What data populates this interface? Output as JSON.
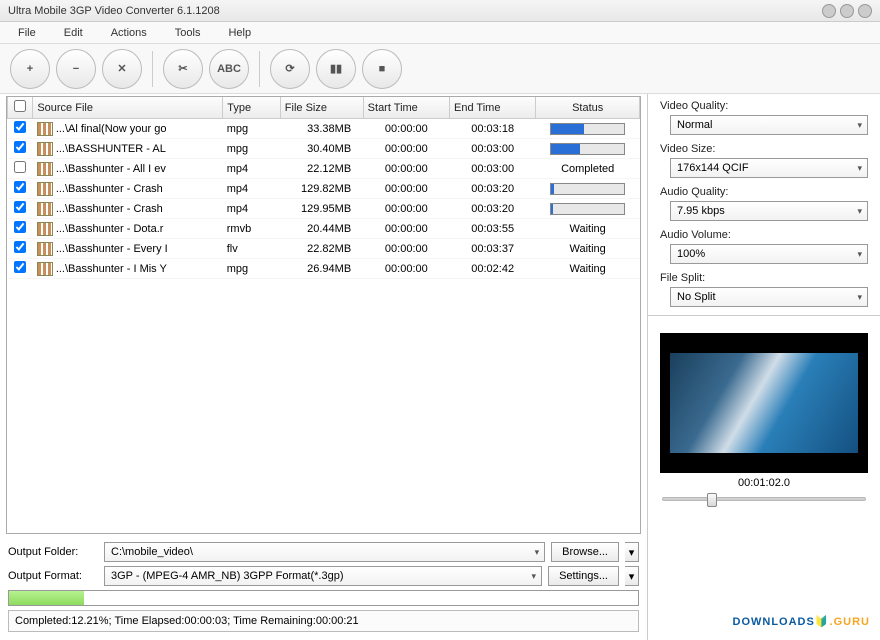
{
  "window": {
    "title": "Ultra Mobile 3GP Video Converter 6.1.1208"
  },
  "menu": {
    "items": [
      "File",
      "Edit",
      "Actions",
      "Tools",
      "Help"
    ]
  },
  "toolbar_icons": [
    "add",
    "remove",
    "clear",
    "cut",
    "abc",
    "refresh",
    "pause",
    "stop"
  ],
  "columns": {
    "check": "",
    "source": "Source File",
    "type": "Type",
    "size": "File Size",
    "start": "Start Time",
    "end": "End Time",
    "status": "Status"
  },
  "rows": [
    {
      "checked": true,
      "name": "...\\Al final(Now your go",
      "type": "mpg",
      "size": "33.38MB",
      "start": "00:00:00",
      "end": "00:03:18",
      "status_kind": "progress",
      "progress": 45
    },
    {
      "checked": true,
      "name": "...\\BASSHUNTER - AL",
      "type": "mpg",
      "size": "30.40MB",
      "start": "00:00:00",
      "end": "00:03:00",
      "status_kind": "progress",
      "progress": 40
    },
    {
      "checked": false,
      "name": "...\\Basshunter - All I ev",
      "type": "mp4",
      "size": "22.12MB",
      "start": "00:00:00",
      "end": "00:03:00",
      "status_kind": "text",
      "status_text": "Completed"
    },
    {
      "checked": true,
      "name": "...\\Basshunter - Crash",
      "type": "mp4",
      "size": "129.82MB",
      "start": "00:00:00",
      "end": "00:03:20",
      "status_kind": "progress",
      "progress": 4
    },
    {
      "checked": true,
      "name": "...\\Basshunter - Crash",
      "type": "mp4",
      "size": "129.95MB",
      "start": "00:00:00",
      "end": "00:03:20",
      "status_kind": "progress",
      "progress": 3
    },
    {
      "checked": true,
      "name": "...\\Basshunter - Dota.r",
      "type": "rmvb",
      "size": "20.44MB",
      "start": "00:00:00",
      "end": "00:03:55",
      "status_kind": "text",
      "status_text": "Waiting"
    },
    {
      "checked": true,
      "name": "...\\Basshunter - Every I",
      "type": "flv",
      "size": "22.82MB",
      "start": "00:00:00",
      "end": "00:03:37",
      "status_kind": "text",
      "status_text": "Waiting"
    },
    {
      "checked": true,
      "name": "...\\Basshunter - I Mis Y",
      "type": "mpg",
      "size": "26.94MB",
      "start": "00:00:00",
      "end": "00:02:42",
      "status_kind": "text",
      "status_text": "Waiting"
    }
  ],
  "output": {
    "folder_label": "Output Folder:",
    "folder_value": "C:\\mobile_video\\",
    "format_label": "Output Format:",
    "format_value": "3GP - (MPEG-4 AMR_NB) 3GPP Format(*.3gp)",
    "browse": "Browse...",
    "settings": "Settings..."
  },
  "progress": {
    "percent": 12,
    "status_text": "Completed:12.21%; Time Elapsed:00:00:03; Time Remaining:00:00:21"
  },
  "settings_panel": {
    "video_quality_label": "Video Quality:",
    "video_quality_value": "Normal",
    "video_size_label": "Video Size:",
    "video_size_value": "176x144  QCIF",
    "audio_quality_label": "Audio Quality:",
    "audio_quality_value": "7.95  kbps",
    "audio_volume_label": "Audio Volume:",
    "audio_volume_value": "100%",
    "file_split_label": "File Split:",
    "file_split_value": "No Split"
  },
  "preview": {
    "time": "00:01:02.0"
  },
  "watermark": {
    "a": "DOWNLOADS",
    "b": ".GURU"
  }
}
